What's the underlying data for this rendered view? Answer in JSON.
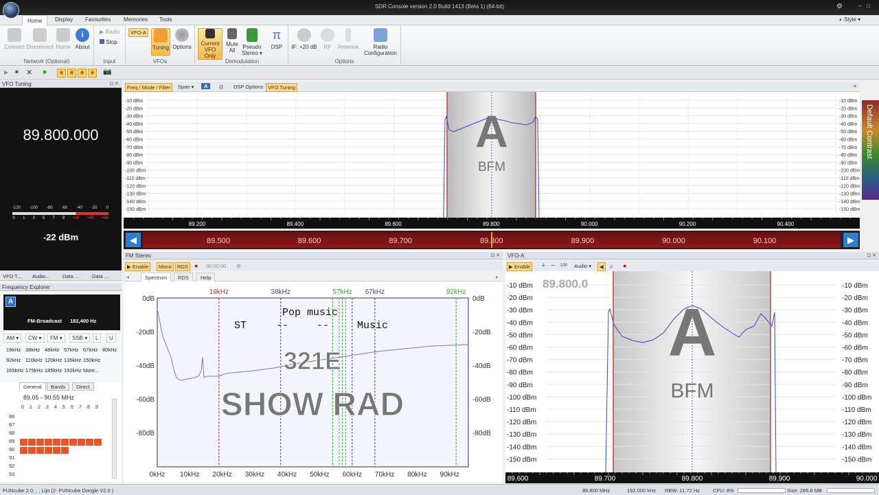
{
  "window": {
    "title": "SDR Console version 2.0 Build 1413 (Beta 1) (64-bit)",
    "style_menu": "Style"
  },
  "ribbon": {
    "tabs": [
      "Home",
      "Display",
      "Favourites",
      "Memories",
      "Tools"
    ],
    "groups": {
      "network": {
        "label": "Network (Optional)",
        "buttons": [
          "Connect",
          "Disconnect",
          "Home",
          "About"
        ]
      },
      "input": {
        "label": "Input",
        "buttons": [
          "Radio",
          "Stop"
        ]
      },
      "vfos": {
        "label": "VFOs",
        "badge": "VFO-A",
        "buttons": [
          "Tuning",
          "Options"
        ]
      },
      "demod": {
        "label": "Demodulation",
        "buttons": [
          "Current VFO Only",
          "Mute All",
          "Pseudo Stereo",
          "DSP"
        ]
      },
      "options": {
        "label": "Options",
        "buttons": [
          "IF: +20 dB",
          "RF",
          "Antenna",
          "Radio Configuration"
        ]
      }
    }
  },
  "vfo_tuning": {
    "title": "VFO Tuning",
    "frequency": "89.800.000",
    "smeter_top": [
      "-120",
      "-100",
      "-80",
      "-60",
      "-40",
      "-20",
      "0"
    ],
    "smeter_bottom": [
      "S",
      "1",
      "3",
      "5",
      "7",
      "9",
      "+20",
      "+40",
      "+60"
    ],
    "level": "-22 dBm"
  },
  "left_tabs": [
    "VFO T...",
    "Audio...",
    "Data ...",
    "Data ..."
  ],
  "freq_explorer": {
    "title": "Frequency Explorer",
    "badge": "A",
    "band": "FM-Broadcast",
    "bandwidth": "182,400 Hz",
    "modes": [
      "AM",
      "CW",
      "FM",
      "SSB",
      "L",
      "U"
    ],
    "bw_row1": [
      "19kHz",
      "38kHz",
      "48kHz",
      "57kHz",
      "67kHz",
      "80kHz"
    ],
    "bw_row2": [
      "92kHz",
      "110kHz",
      "120kHz",
      "135kHz",
      "150kHz"
    ],
    "bw_row3": [
      "165kHz",
      "175kHz",
      "185kHz",
      "192kHz",
      "More..."
    ]
  },
  "band_grid": {
    "tabs": [
      "General",
      "Bands",
      "Direct"
    ],
    "range": "89.05 - 90.55 MHz",
    "columns": [
      ".0",
      ".1",
      ".2",
      ".3",
      ".4",
      ".5",
      ".6",
      ".7",
      ".8",
      ".9"
    ],
    "rows": [
      "86",
      "87",
      "88",
      "89",
      "90",
      "91",
      "92",
      "93"
    ]
  },
  "main_spectrum": {
    "toolbar": [
      "Freq / Mode / Filter",
      "Span",
      "A",
      "DSP Options",
      "VFO Tuning"
    ],
    "db_labels": [
      "-10 dBm",
      "-20 dBm",
      "-30 dBm",
      "-40 dBm",
      "-50 dBm",
      "-60 dBm",
      "-70 dBm",
      "-80 dBm",
      "-90 dBm",
      "-100 dBm",
      "-110 dBm",
      "-120 dBm",
      "-130 dBm",
      "-140 dBm",
      "-150 dBm"
    ],
    "freq_labels": [
      "89.200",
      "89.400",
      "89.600",
      "89.800",
      "90.000",
      "90.200",
      "90.400"
    ],
    "scroll_labels": [
      "89.500",
      "89.600",
      "89.700",
      "89.800",
      "89.900",
      "90.000",
      "90.100"
    ],
    "vfo_letter": "A",
    "mode": "BFM",
    "contrast": "Default Contrast"
  },
  "fm_stereo": {
    "title": "FM Stereo",
    "toolbar": [
      "Enable",
      "Mono",
      "RDS",
      "00:00:00"
    ],
    "tabs": [
      "Spectrum",
      "RDS",
      "Help"
    ],
    "markers": [
      "19kHz",
      "38kHz",
      "57kHz",
      "67kHz",
      "92kHz"
    ],
    "y_labels": [
      "0dB",
      "-20dB",
      "-40dB",
      "-60dB",
      "-80dB"
    ],
    "x_labels": [
      "0kHz",
      "10kHz",
      "20kHz",
      "30kHz",
      "40kHz",
      "50kHz",
      "60kHz",
      "70kHz",
      "80kHz",
      "90kHz"
    ],
    "annotations": [
      "Pop music",
      "ST",
      "--",
      "--",
      "Music"
    ],
    "rds_code": "321E",
    "rds_name": "SHOW RAD"
  },
  "vfo_a": {
    "title": "VFO-A",
    "toolbar": [
      "Enable",
      "100",
      "Audio"
    ],
    "frequency": "89.800.0",
    "db_labels": [
      "-10 dBm",
      "-20 dBm",
      "-30 dBm",
      "-40 dBm",
      "-50 dBm",
      "-60 dBm",
      "-70 dBm",
      "-80 dBm",
      "-90 dBm",
      "-100 dBm",
      "-110 dBm",
      "-120 dBm",
      "-130 dBm",
      "-140 dBm",
      "-150 dBm"
    ],
    "freq_labels": [
      "89.600",
      "89.700",
      "89.800",
      "89.900",
      "90.000"
    ],
    "vfo_letter": "A",
    "mode": "BFM"
  },
  "status": {
    "device": "FUNcube 2.0, , , Lijn (2- FUNcube Dongle V2.0 )",
    "freq": "89.800 MHz",
    "rate": "192.000 kHz",
    "rbw": "RBW: 11.72 Hz",
    "cpu": "CPU: 8%",
    "size": "Size: 285.8 MB"
  },
  "colors": {
    "accent": "#f4511e",
    "spectrum_line": "#3344cc",
    "marker_red": "#b02020"
  }
}
